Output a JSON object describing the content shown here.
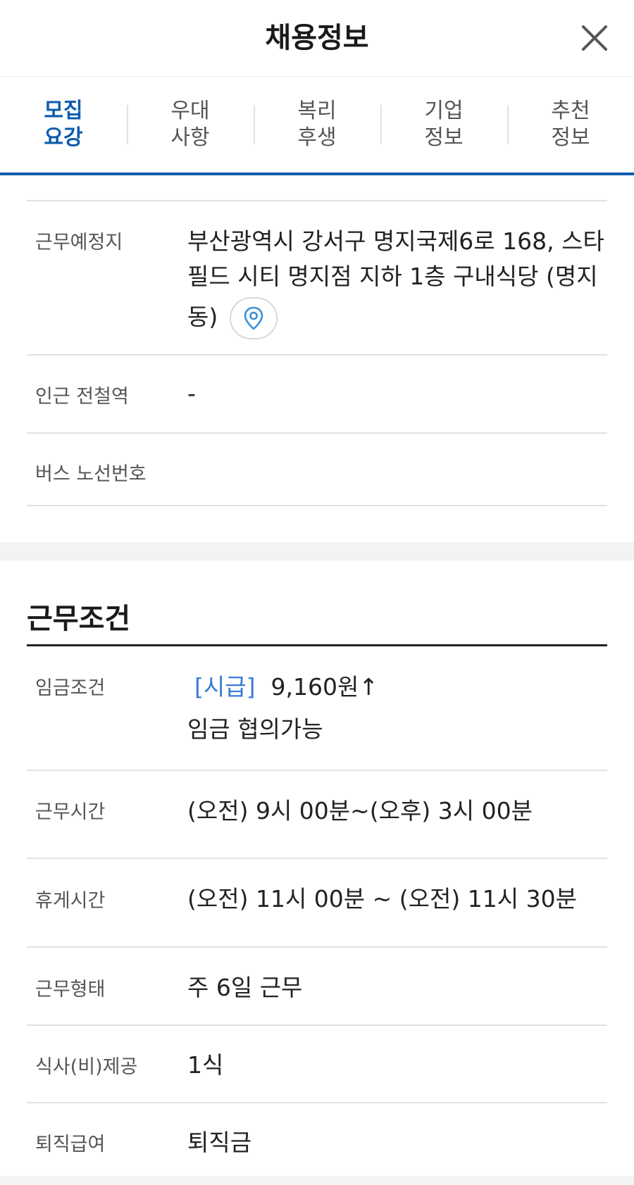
{
  "header": {
    "title": "채용정보",
    "close_icon": "close-icon"
  },
  "tabs": [
    {
      "line1": "모집",
      "line2": "요강",
      "active": true
    },
    {
      "line1": "우대",
      "line2": "사항",
      "active": false
    },
    {
      "line1": "복리",
      "line2": "후생",
      "active": false
    },
    {
      "line1": "기업",
      "line2": "정보",
      "active": false
    },
    {
      "line1": "추천",
      "line2": "정보",
      "active": false
    }
  ],
  "location": {
    "work_place_label": "근무예정지",
    "work_place_line1": "부산광역시 강서구 명지국제6로 168, 스타",
    "work_place_line2": "필드 시티 명지점 지하 1층 구내식당 (명지",
    "work_place_line3": "동)",
    "map_icon": "map-pin-icon",
    "subway_label": "인근 전철역",
    "subway_value": "-",
    "bus_label": "버스 노선번호",
    "bus_value": ""
  },
  "conditions": {
    "section_title": "근무조건",
    "wage_label": "임금조건",
    "wage_type": "[시급]",
    "wage_amount": "9,160원↑",
    "wage_note": "임금 협의가능",
    "hours_label": "근무시간",
    "hours_value": "(오전) 9시 00분~(오후) 3시 00분",
    "break_label": "휴게시간",
    "break_value": "(오전) 11시 00분 ~ (오전) 11시 30분",
    "type_label": "근무형태",
    "type_value": "주 6일 근무",
    "meal_label": "식사(비)제공",
    "meal_value": "1식",
    "severance_label": "퇴직급여",
    "severance_value": "퇴직금"
  },
  "colors": {
    "accent": "#0b5cad",
    "wage_tag": "#3a7bd5",
    "divider": "#e0e0e0",
    "band": "#f2f3f5"
  }
}
